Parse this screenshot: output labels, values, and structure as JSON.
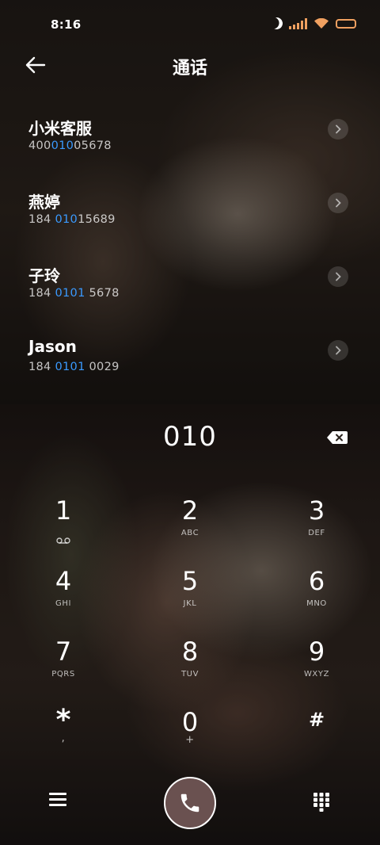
{
  "status_bar": {
    "time": "8:16"
  },
  "header": {
    "title": "通话"
  },
  "contacts": [
    {
      "name": "小米客服",
      "number_pre": "400",
      "number_hl": "010",
      "number_post": "05678"
    },
    {
      "name": "燕婷",
      "number_pre": "184 ",
      "number_hl": "010",
      "number_post": "15689"
    },
    {
      "name": "子玲",
      "number_pre": "184 ",
      "number_hl": "0101",
      "number_post": " 5678"
    },
    {
      "name": "Jason",
      "number_pre": "184 ",
      "number_hl": "0101",
      "number_post": " 0029"
    }
  ],
  "dialer": {
    "input": "010"
  },
  "keys": [
    {
      "digit": "1",
      "letters": ""
    },
    {
      "digit": "2",
      "letters": "ABC"
    },
    {
      "digit": "3",
      "letters": "DEF"
    },
    {
      "digit": "4",
      "letters": "GHI"
    },
    {
      "digit": "5",
      "letters": "JKL"
    },
    {
      "digit": "6",
      "letters": "MNO"
    },
    {
      "digit": "7",
      "letters": "PQRS"
    },
    {
      "digit": "8",
      "letters": "TUV"
    },
    {
      "digit": "9",
      "letters": "WXYZ"
    },
    {
      "digit": "*",
      "letters": ","
    },
    {
      "digit": "0",
      "letters": "+"
    },
    {
      "digit": "#",
      "letters": ""
    }
  ],
  "colors": {
    "highlight": "#3a9aff",
    "status_accent": "#f0a060",
    "call_button": "#6a5150"
  },
  "icons": {
    "status": [
      "moon-icon",
      "signal-icon",
      "wifi-icon",
      "battery-icon"
    ],
    "header": "back-arrow-icon",
    "row_action": "chevron-right-icon",
    "backspace": "backspace-icon",
    "key_1": "voicemail-icon",
    "bottom": [
      "menu-icon",
      "phone-icon",
      "dialpad-grid-icon"
    ]
  }
}
